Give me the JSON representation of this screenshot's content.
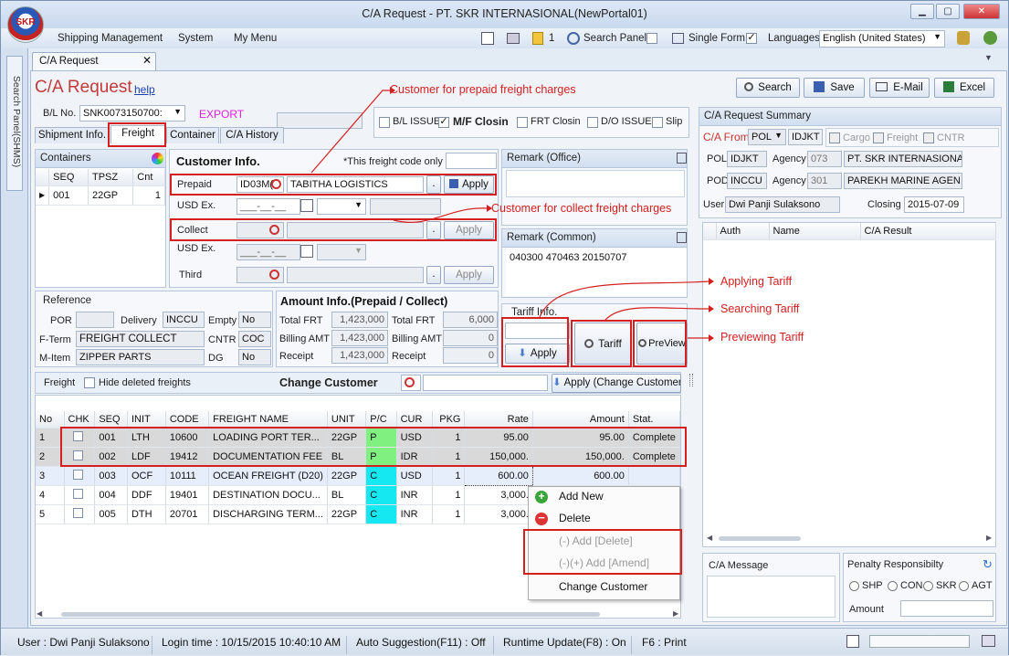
{
  "window": {
    "title": "C/A Request - PT. SKR INTERNASIONAL(NewPortal01)",
    "logo_text": "SKR"
  },
  "menu": {
    "items": [
      "Shipping Management",
      "System",
      "My Menu"
    ],
    "notif_count": "1",
    "search_panel": "Search Panel",
    "single_form": "Single Form",
    "languages": "Languages",
    "language_value": "English (United States)"
  },
  "side": {
    "vertical_tab": "Search Panel(SHMS)"
  },
  "doc_tab": {
    "label": "C/A Request"
  },
  "header": {
    "title": "C/A Request",
    "help": "help",
    "bl_label": "B/L No.",
    "bl_value": "SNK0073150700:",
    "export": "EXPORT"
  },
  "toolbar": {
    "search": "Search",
    "save": "Save",
    "email": "E-Mail",
    "excel": "Excel"
  },
  "flags": {
    "bl_issue": "B/L ISSUE",
    "mf_closing": "M/F Closin",
    "frt_closing": "FRT Closin",
    "do_issue": "D/O ISSUE",
    "slip": "Slip"
  },
  "tabs": [
    "Shipment Info.",
    "Freight",
    "Container",
    "C/A History"
  ],
  "containers": {
    "title": "Containers",
    "headers": [
      "SEQ",
      "TPSZ",
      "Cnt"
    ],
    "rows": [
      {
        "seq": "001",
        "tpsz": "22GP",
        "cnt": "1"
      }
    ]
  },
  "customer": {
    "title": "Customer Info.",
    "freight_code_note": "*This freight code only",
    "prepaid_label": "Prepaid",
    "prepaid_code": "ID03M(",
    "prepaid_name": "TABITHA LOGISTICS",
    "usd_ex": "USD Ex.",
    "date_placeholder": "___-__-__",
    "collect_label": "Collect",
    "third_label": "Third",
    "apply": "Apply",
    "dot": "."
  },
  "remarks": {
    "office": "Remark (Office)",
    "common": "Remark (Common)",
    "common_text": "040300 470463 20150707"
  },
  "reference": {
    "title": "Reference",
    "por": "POR",
    "delivery": "Delivery",
    "delivery_value": "INCCU",
    "empty": "Empty",
    "empty_value": "No",
    "fterm": "F-Term",
    "fterm_value": "FREIGHT COLLECT",
    "cntr": "CNTR",
    "cntr_value": "COC",
    "mitem": "M-Item",
    "mitem_value": "ZIPPER PARTS",
    "dg": "DG",
    "dg_value": "No"
  },
  "amount": {
    "title": "Amount Info.(Prepaid / Collect)",
    "total_frt": "Total FRT",
    "billing_amt": "Billing AMT",
    "receipt": "Receipt",
    "pp_total": "1,423,000",
    "pp_billing": "1,423,000",
    "pp_receipt": "1,423,000",
    "cc_total": "6,000",
    "cc_billing": "0",
    "cc_receipt": "0"
  },
  "tariff": {
    "title": "Tariff Info.",
    "apply": "Apply",
    "tariff": "Tariff",
    "preview": "PreView"
  },
  "freight_bar": {
    "label": "Freight",
    "hide_deleted": "Hide deleted freights",
    "change_customer": "Change Customer",
    "apply_change": "Apply (Change Customer"
  },
  "freight": {
    "headers": [
      "No",
      "CHK",
      "SEQ",
      "INIT",
      "CODE",
      "FREIGHT NAME",
      "UNIT",
      "P/C",
      "CUR",
      "PKG",
      "Rate",
      "Amount",
      "Stat."
    ],
    "rows": [
      {
        "no": "1",
        "seq": "001",
        "init": "LTH",
        "code": "10600",
        "name": "LOADING PORT TER...",
        "unit": "22GP",
        "pc": "P",
        "cur": "USD",
        "pkg": "1",
        "rate": "95.00",
        "amount": "95.00",
        "stat": "Complete"
      },
      {
        "no": "2",
        "seq": "002",
        "init": "LDF",
        "code": "19412",
        "name": "DOCUMENTATION FEE",
        "unit": "BL",
        "pc": "P",
        "cur": "IDR",
        "pkg": "1",
        "rate": "150,000.",
        "amount": "150,000.",
        "stat": "Complete"
      },
      {
        "no": "3",
        "seq": "003",
        "init": "OCF",
        "code": "10111",
        "name": "OCEAN FREIGHT (D20)",
        "unit": "22GP",
        "pc": "C",
        "cur": "USD",
        "pkg": "1",
        "rate": "600.00",
        "amount": "600.00",
        "stat": ""
      },
      {
        "no": "4",
        "seq": "004",
        "init": "DDF",
        "code": "19401",
        "name": "DESTINATION DOCU...",
        "unit": "BL",
        "pc": "C",
        "cur": "INR",
        "pkg": "1",
        "rate": "3,000.",
        "amount": "",
        "stat": ""
      },
      {
        "no": "5",
        "seq": "005",
        "init": "DTH",
        "code": "20701",
        "name": "DISCHARGING TERM...",
        "unit": "22GP",
        "pc": "C",
        "cur": "INR",
        "pkg": "1",
        "rate": "3,000.",
        "amount": "",
        "stat": ""
      }
    ]
  },
  "context_menu": {
    "add_new": "Add New",
    "delete": "Delete",
    "add_delete": "(-) Add [Delete]",
    "add_amend": "(-)(+) Add [Amend]",
    "change_customer": "Change Customer"
  },
  "summary": {
    "title": "C/A Request Summary",
    "ca_from": "C/A From",
    "ca_from_value": "POL",
    "ca_from_code": "IDJKT",
    "cargo": "Cargo",
    "freight": "Freight",
    "cntr": "CNTR",
    "pol": "POL",
    "pol_code": "IDJKT",
    "agency": "Agency",
    "pol_agency_code": "073",
    "pol_agency_name": "PT. SKR INTERNASIONAL",
    "pod": "POD",
    "pod_code": "INCCU",
    "pod_agency_code": "301",
    "pod_agency_name": "PAREKH MARINE AGEN...",
    "user": "User",
    "user_value": "Dwi Panji Sulaksono",
    "closing": "Closing",
    "closing_value": "2015-07-09",
    "result_headers": [
      "Auth",
      "Name",
      "C/A Result"
    ],
    "message": "C/A Message",
    "penalty": "Penalty Responsibilty",
    "penalty_opts": [
      "SHP",
      "CON",
      "SKR",
      "AGT"
    ],
    "amount": "Amount"
  },
  "annotations": {
    "prepaid": "Customer for prepaid freight charges",
    "collect": "Customer for collect freight charges",
    "applying": "Applying Tariff",
    "searching": "Searching Tariff",
    "previewing": "Previewing Tariff"
  },
  "status": {
    "user": "User : Dwi Panji Sulaksono",
    "login": "Login time : 10/15/2015 10:40:10 AM",
    "auto": "Auto Suggestion(F11) : Off",
    "runtime": "Runtime Update(F8) : On",
    "print": "F6 : Print"
  }
}
